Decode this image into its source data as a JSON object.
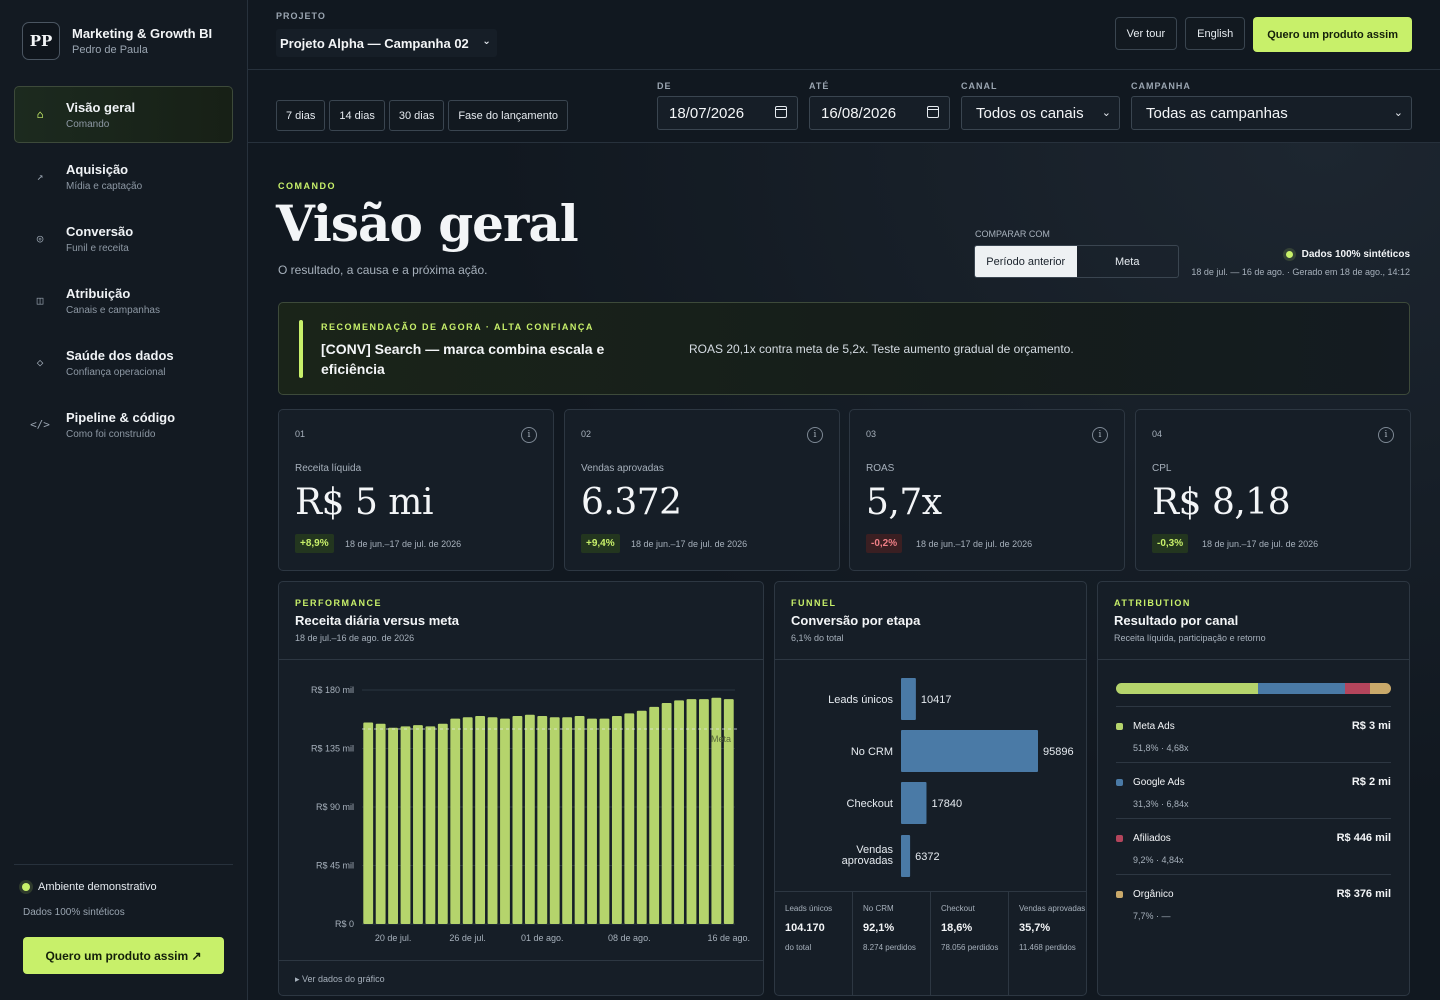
{
  "brand": {
    "logo": "PP",
    "title": "Marketing & Growth BI",
    "subtitle": "Pedro de Paula"
  },
  "nav": [
    {
      "icon": "home-icon",
      "glyph": "⌂",
      "label": "Visão geral",
      "desc": "Comando",
      "active": true
    },
    {
      "icon": "arrow-icon",
      "glyph": "↗",
      "label": "Aquisição",
      "desc": "Mídia e captação"
    },
    {
      "icon": "target-icon",
      "glyph": "◎",
      "label": "Conversão",
      "desc": "Funil e receita"
    },
    {
      "icon": "columns-icon",
      "glyph": "◫",
      "label": "Atribuição",
      "desc": "Canais e campanhas"
    },
    {
      "icon": "diamond-icon",
      "glyph": "◇",
      "label": "Saúde dos dados",
      "desc": "Confiança operacional"
    },
    {
      "icon": "code-icon",
      "glyph": "</>",
      "label": "Pipeline & código",
      "desc": "Como foi construído"
    }
  ],
  "sidebar_footer": {
    "env": "Ambiente demonstrativo",
    "env_sub": "Dados 100% sintéticos",
    "cta": "Quero um produto assim ↗"
  },
  "topbar": {
    "project_label": "PROJETO",
    "project_value": "Projeto Alpha — Campanha 02",
    "tour": "Ver tour",
    "language": "English",
    "cta": "Quero um produto assim"
  },
  "filters": {
    "quick": [
      "7 dias",
      "14 dias",
      "30 dias",
      "Fase do lançamento"
    ],
    "from_label": "DE",
    "from_value": "18/07/2026",
    "to_label": "ATÉ",
    "to_value": "16/08/2026",
    "channel_label": "CANAL",
    "channel_value": "Todos os canais",
    "campaign_label": "CAMPANHA",
    "campaign_value": "Todas as campanhas"
  },
  "header": {
    "eyebrow": "COMANDO",
    "title": "Visão geral",
    "subtitle": "O resultado, a causa e a próxima ação.",
    "compare_label": "COMPARAR COM",
    "compare_options": [
      "Período anterior",
      "Meta"
    ],
    "synthetic": "Dados 100% sintéticos",
    "synthetic_sub": "18 de jul. — 16 de ago. · Gerado em 18 de ago., 14:12"
  },
  "recommendation": {
    "eyebrow": "RECOMENDAÇÃO DE AGORA · ALTA CONFIANÇA",
    "title": "[CONV] Search — marca combina escala e eficiência",
    "text": "ROAS 20,1x contra meta de 5,2x. Teste aumento gradual de orçamento."
  },
  "kpis": [
    {
      "num": "01",
      "label": "Receita líquida",
      "value": "R$ 5 mi",
      "delta": "+8,9%",
      "trend": "up",
      "period": "18 de jun.–17 de jul. de 2026"
    },
    {
      "num": "02",
      "label": "Vendas aprovadas",
      "value": "6.372",
      "delta": "+9,4%",
      "trend": "up",
      "period": "18 de jun.–17 de jul. de 2026"
    },
    {
      "num": "03",
      "label": "ROAS",
      "value": "5,7x",
      "delta": "-0,2%",
      "trend": "down",
      "period": "18 de jun.–17 de jul. de 2026"
    },
    {
      "num": "04",
      "label": "CPL",
      "value": "R$ 8,18",
      "delta": "-0,3%",
      "trend": "up",
      "period": "18 de jun.–17 de jul. de 2026"
    }
  ],
  "performance": {
    "eyebrow": "PERFORMANCE",
    "title": "Receita diária versus meta",
    "subtitle": "18 de jul.–16 de ago. de 2026",
    "footer": "▸ Ver dados do gráfico"
  },
  "funnel": {
    "eyebrow": "FUNNEL",
    "title": "Conversão por etapa",
    "subtitle": "6,1% do total",
    "stats": [
      {
        "label": "Leads únicos",
        "value": "104.170",
        "sub": "do total"
      },
      {
        "label": "No CRM",
        "value": "92,1%",
        "sub": "8.274 perdidos"
      },
      {
        "label": "Checkout",
        "value": "18,6%",
        "sub": "78.056 perdidos"
      },
      {
        "label": "Vendas aprovadas",
        "value": "35,7%",
        "sub": "11.468 perdidos"
      }
    ]
  },
  "attribution": {
    "eyebrow": "ATTRIBUTION",
    "title": "Resultado por canal",
    "subtitle": "Receita líquida, participação e retorno",
    "channels": [
      {
        "name": "Meta Ads",
        "value": "R$ 3 mi",
        "meta": "51,8% · 4,68x",
        "share": 51.8,
        "color": "#b5d46c"
      },
      {
        "name": "Google Ads",
        "value": "R$ 2 mi",
        "meta": "31,3% · 6,84x",
        "share": 31.3,
        "color": "#4a7aa6"
      },
      {
        "name": "Afiliados",
        "value": "R$ 446 mil",
        "meta": "9,2% · 4,84x",
        "share": 9.2,
        "color": "#b4455c"
      },
      {
        "name": "Orgânico",
        "value": "R$ 376 mil",
        "meta": "7,7% · —",
        "share": 7.7,
        "color": "#c9a96a"
      }
    ]
  },
  "colors": {
    "accent": "#c8f06a",
    "bar": "#b5d46c",
    "funnel": "#4a7aa6",
    "negative": "#ef7f86"
  },
  "chart_data": [
    {
      "type": "bar",
      "title": "Receita diária versus meta",
      "ylim": [
        0,
        180000
      ],
      "y_ticks": [
        "R$ 0",
        "R$ 45 mil",
        "R$ 90 mil",
        "R$ 135 mil",
        "R$ 180 mil"
      ],
      "x_ticks": [
        "20 de jul.",
        "26 de jul.",
        "01 de ago.",
        "08 de ago.",
        "16 de ago."
      ],
      "target_label": "Meta",
      "target": 150000,
      "categories": [
        "18/07",
        "19/07",
        "20/07",
        "21/07",
        "22/07",
        "23/07",
        "24/07",
        "25/07",
        "26/07",
        "27/07",
        "28/07",
        "29/07",
        "30/07",
        "31/07",
        "01/08",
        "02/08",
        "03/08",
        "04/08",
        "05/08",
        "06/08",
        "07/08",
        "08/08",
        "09/08",
        "10/08",
        "11/08",
        "12/08",
        "13/08",
        "14/08",
        "15/08",
        "16/08"
      ],
      "values": [
        155000,
        154000,
        151000,
        152000,
        153000,
        152000,
        154000,
        158000,
        159000,
        160000,
        159000,
        158000,
        160000,
        161000,
        160000,
        159000,
        159000,
        160000,
        158000,
        158000,
        160000,
        162000,
        164000,
        167000,
        170000,
        172000,
        173000,
        173000,
        174000,
        173000
      ]
    },
    {
      "type": "bar",
      "orientation": "horizontal",
      "title": "Conversão por etapa",
      "categories": [
        "Leads únicos",
        "No CRM",
        "Checkout",
        "Vendas aprovadas"
      ],
      "values": [
        10417,
        95896,
        17840,
        6372
      ]
    }
  ]
}
